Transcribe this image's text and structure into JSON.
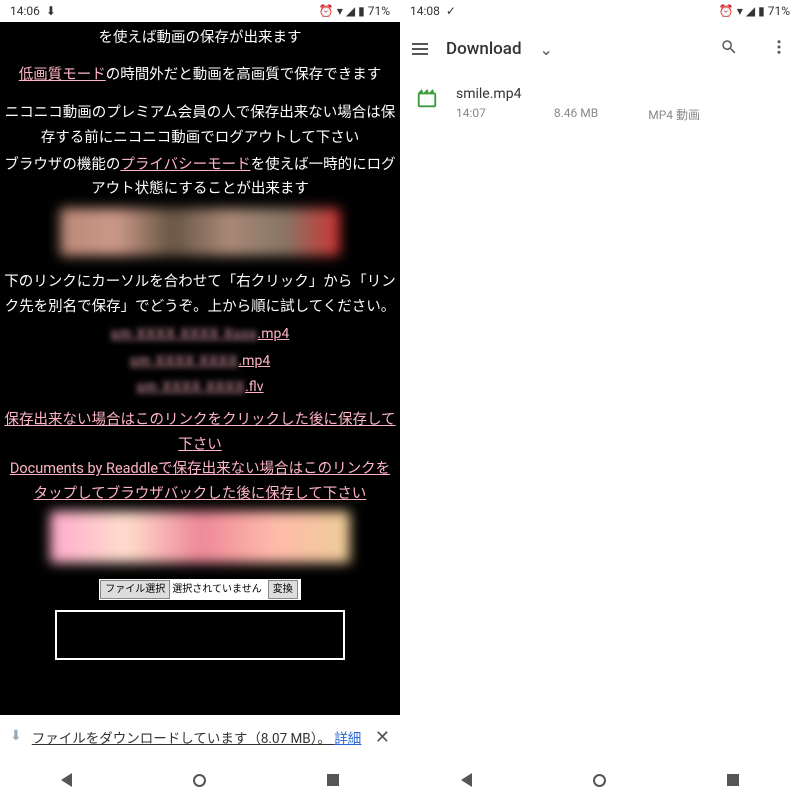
{
  "left": {
    "status": {
      "time": "14:06",
      "battery": "71%"
    },
    "text": {
      "line1": "を使えば動画の保存が出来ます",
      "link1": "低画質モード",
      "line2": "の時間外だと動画を高画質で保存できます",
      "line3": "ニコニコ動画のプレミアム会員の人で保存出来ない場合は保存する前にニコニコ動画でログアウトして下さい",
      "line4a": "ブラウザの機能の",
      "link2": "プライバシーモード",
      "line4b": "を使えば一時的にログアウト状態にすることが出来ます",
      "line5": "下のリンクにカーソルを合わせて「右クリック」から「リンク先を別名で保存」でどうぞ。上から順に試してください。",
      "links": [
        ".mp4",
        ".mp4",
        ".flv"
      ],
      "link3": "保存出来ない場合はこのリンクをクリックした後に保存して下さい",
      "link4": "Documents by Readdleで保存出来ない場合はこのリンクをタップしてブラウザバックした後に保存して下さい",
      "file_btn": "ファイル選択",
      "file_none": "選択されていません",
      "conv_btn": "変換"
    },
    "notif": {
      "msg": "ファイルをダウンロードしています（8.07 MB）。",
      "details": "詳細"
    }
  },
  "right": {
    "status": {
      "time": "14:08",
      "battery": "71%"
    },
    "appbar": {
      "title": "Download"
    },
    "file": {
      "name": "smile.mp4",
      "time": "14:07",
      "size": "8.46 MB",
      "type": "MP4 動画"
    }
  }
}
